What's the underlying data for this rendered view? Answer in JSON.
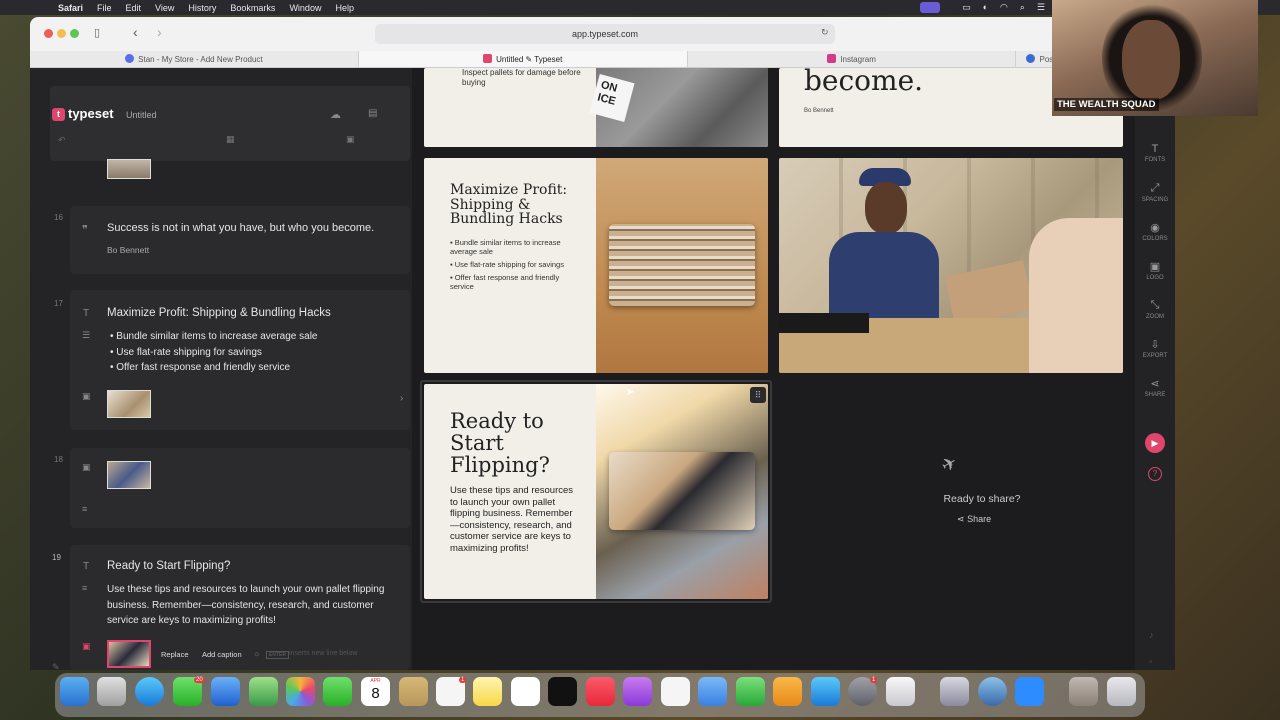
{
  "menubar": {
    "app": "Safari",
    "items": [
      "File",
      "Edit",
      "View",
      "History",
      "Bookmarks",
      "Window",
      "Help"
    ]
  },
  "browser": {
    "url": "app.typeset.com",
    "tabs": [
      {
        "label": "Stan - My Store - Add New Product",
        "color": "#5a6ee8"
      },
      {
        "label": "Untitled ✎ Typeset",
        "color": "#e0456b"
      },
      {
        "label": "Instagram",
        "color": "#d43a8a"
      },
      {
        "label": "Post Attendee",
        "color": "#3a6ad6"
      }
    ]
  },
  "app": {
    "logo": "typeset",
    "doc_title": "Untitled"
  },
  "slides_panel": {
    "items": [
      {
        "num": "16",
        "quote": "Success is not in what you have, but who you become.",
        "author": "Bo Bennett"
      },
      {
        "num": "17",
        "title": "Maximize Profit: Shipping & Bundling Hacks",
        "bullets": [
          "Bundle similar items to increase average sale",
          "Use flat-rate shipping for savings",
          "Offer fast response and friendly service"
        ]
      },
      {
        "num": "18"
      },
      {
        "num": "19",
        "title": "Ready to Start Flipping?",
        "body": "Use these tips and resources to launch your own pallet flipping business. Remember—consistency, research, and customer service are keys to maximizing profits!"
      }
    ],
    "image_actions": {
      "replace": "Replace",
      "caption": "Add caption",
      "hint_key": "ENTER",
      "hint": "inserts new line below"
    }
  },
  "canvas": {
    "top_slide_left_text": "Inspect pallets for damage before buying",
    "top_slide_sign": "ON\nICE",
    "top_slide_right_big": "become.",
    "top_slide_right_author": "Bo Bennett",
    "shipping_slide": {
      "title": "Maximize Profit: Shipping & Bundling Hacks",
      "bullets": [
        "Bundle similar items to increase average sale",
        "Use flat-rate shipping for savings",
        "Offer fast response and friendly service"
      ]
    },
    "flipping_slide": {
      "title": "Ready to Start Flipping?",
      "body": "Use these tips and resources to launch your own pallet flipping business. Remember—consistency, research, and customer service are keys to maximizing profits!"
    },
    "share": {
      "prompt": "Ready to share?",
      "button": "Share"
    }
  },
  "toolbar": {
    "items": [
      {
        "label": "FONTS",
        "icon": "T"
      },
      {
        "label": "SPACING",
        "icon": "⤢"
      },
      {
        "label": "COLORS",
        "icon": "◉"
      },
      {
        "label": "LOGO",
        "icon": "▣"
      },
      {
        "label": "ZOOM",
        "icon": "⤡"
      },
      {
        "label": "EXPORT",
        "icon": "⇩"
      },
      {
        "label": "SHARE",
        "icon": "⋖"
      }
    ]
  },
  "webcam": {
    "label": "THE WEALTH SQUAD"
  },
  "dock": {
    "calendar_month": "APR",
    "calendar_day": "8",
    "badges": {
      "messages": "20",
      "reminders": "1",
      "settings": "1"
    }
  }
}
